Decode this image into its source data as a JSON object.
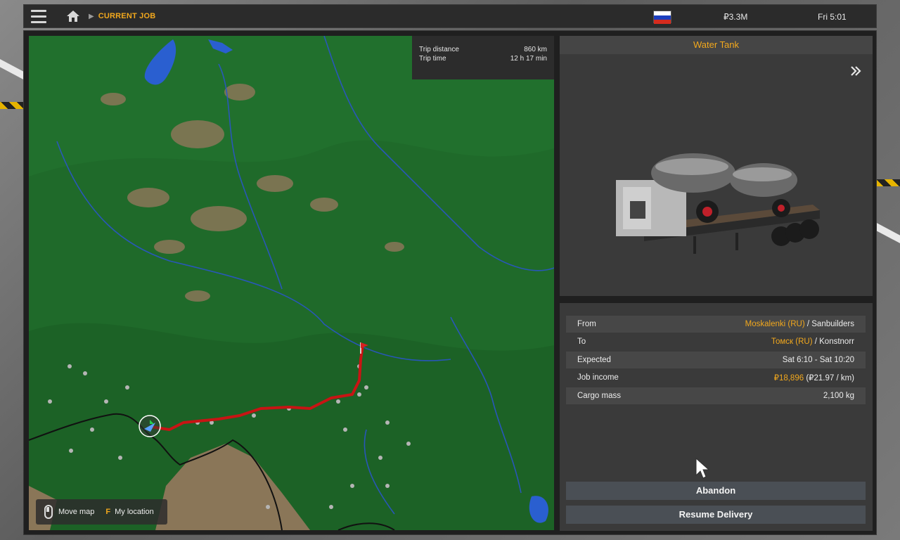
{
  "topbar": {
    "breadcrumb": "CURRENT JOB",
    "money": "₽3.3M",
    "clock": "Fri 5:01",
    "flag_colors": [
      "#ffffff",
      "#1c3fbf",
      "#d52b1e"
    ]
  },
  "map": {
    "trip_distance_label": "Trip distance",
    "trip_distance_value": "860 km",
    "trip_time_label": "Trip time",
    "trip_time_value": "12 h 17 min",
    "legend_move_label": "Move map",
    "legend_key": "F",
    "legend_location_label": "My location"
  },
  "cargo": {
    "title": "Water Tank"
  },
  "job": {
    "rows": [
      {
        "label": "From",
        "value_highlight": "Moskalenki (RU)",
        "value_rest": " / Sanbuilders"
      },
      {
        "label": "To",
        "value_highlight": "Томск (RU)",
        "value_rest": " / Konstnorr"
      },
      {
        "label": "Expected",
        "value_highlight": "Sat 6:10 - Sat 10:20",
        "value_rest": ""
      },
      {
        "label": "Job income",
        "value_highlight": "₽18,896",
        "value_rest": " (₽21.97 / km)"
      },
      {
        "label": "Cargo mass",
        "value_highlight": "2,100 kg",
        "value_rest": ""
      }
    ],
    "abandon_label": "Abandon",
    "resume_label": "Resume Delivery"
  },
  "colors": {
    "accent": "#f2a81d",
    "route": "#c81414",
    "map_forest": "#1f6a2a",
    "panel": "#3a3a3a"
  }
}
